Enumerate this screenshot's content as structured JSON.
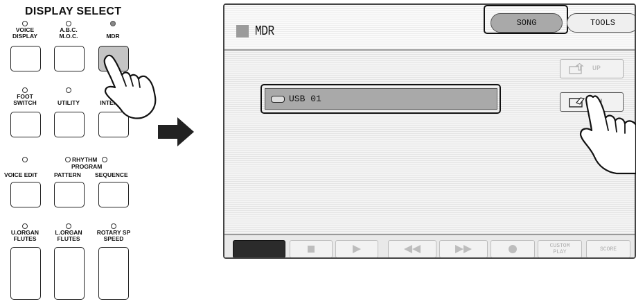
{
  "panel": {
    "title": "DISPLAY SELECT",
    "buttons": {
      "voice_display": "VOICE\nDISPLAY",
      "abc_moc": "A.B.C.\nM.O.C.",
      "mdr": "MDR",
      "foot_switch": "FOOT\nSWITCH",
      "utility": "UTILITY",
      "internet": "INTERNE",
      "voice_edit": "VOICE EDIT",
      "rhythm_program": "RHYTHM",
      "program": "PROGRAM",
      "pattern": "PATTERN",
      "sequence": "SEQUENCE",
      "u_organ_flutes": "U.ORGAN\nFLUTES",
      "l_organ_flutes": "L.ORGAN\nFLUTES",
      "rotary_sp_speed": "ROTARY SP\nSPEED"
    }
  },
  "screen": {
    "title": "MDR",
    "tabs": {
      "song": "SONG",
      "tools": "TOOLS"
    },
    "side": {
      "up": "UP",
      "in": "IN"
    },
    "list": [
      {
        "label": "USB 01"
      }
    ],
    "transport": {
      "custom_play": "CUSTOM\nPLAY",
      "score": "SCORE"
    }
  }
}
